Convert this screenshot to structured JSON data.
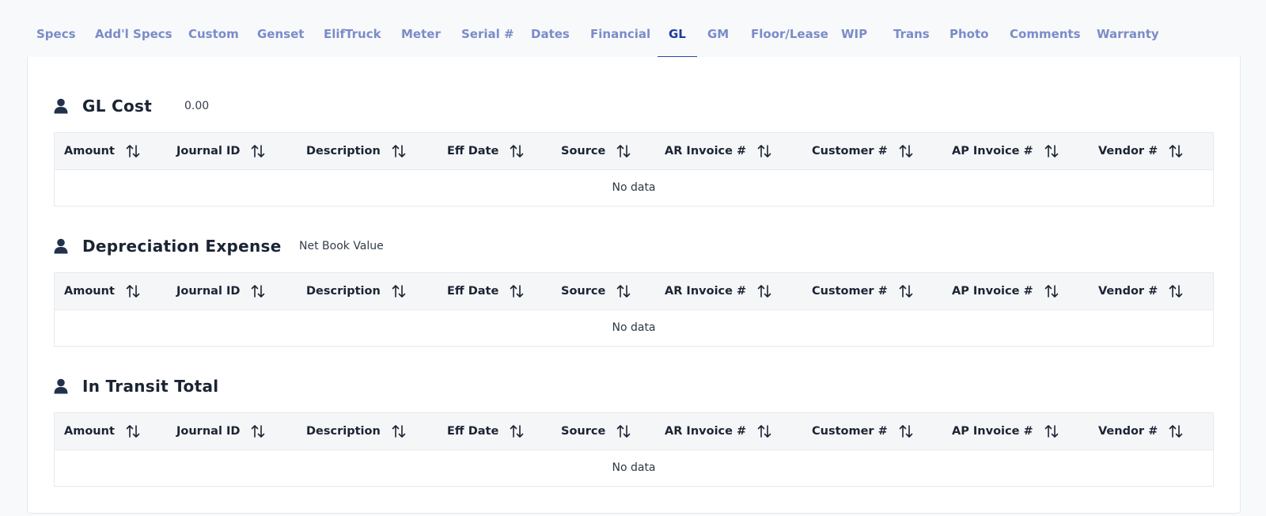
{
  "tabs": [
    {
      "label": "Specs",
      "active": false
    },
    {
      "label": "Add'l Specs",
      "active": false
    },
    {
      "label": "Custom",
      "active": false
    },
    {
      "label": "Genset",
      "active": false
    },
    {
      "label": "ElifTruck",
      "active": false
    },
    {
      "label": "Meter",
      "active": false
    },
    {
      "label": "Serial #",
      "active": false
    },
    {
      "label": "Dates",
      "active": false
    },
    {
      "label": "Financial",
      "active": false
    },
    {
      "label": "GL",
      "active": true
    },
    {
      "label": "GM",
      "active": false
    },
    {
      "label": "Floor/Lease",
      "active": false
    },
    {
      "label": "WIP",
      "active": false
    },
    {
      "label": "Trans",
      "active": false
    },
    {
      "label": "Photo",
      "active": false
    },
    {
      "label": "Comments",
      "active": false
    },
    {
      "label": "Warranty",
      "active": false
    }
  ],
  "columns": [
    "Amount",
    "Journal ID",
    "Description",
    "Eff Date",
    "Source",
    "AR Invoice #",
    "Customer #",
    "AP Invoice #",
    "Vendor #"
  ],
  "sections": [
    {
      "title": "GL Cost",
      "value": "0.00",
      "icon": "user-icon",
      "empty_text": "No data"
    },
    {
      "title": "Depreciation Expense",
      "value": "Net Book Value",
      "icon": "user-icon",
      "empty_text": "No data"
    },
    {
      "title": "In Transit Total",
      "value": "",
      "icon": "user-icon",
      "empty_text": "No data"
    }
  ],
  "colors": {
    "tab_text": "#7a8cc9",
    "tab_active": "#1f3aa1",
    "heading": "#1b2433",
    "header_bg": "#f5f6f8"
  }
}
